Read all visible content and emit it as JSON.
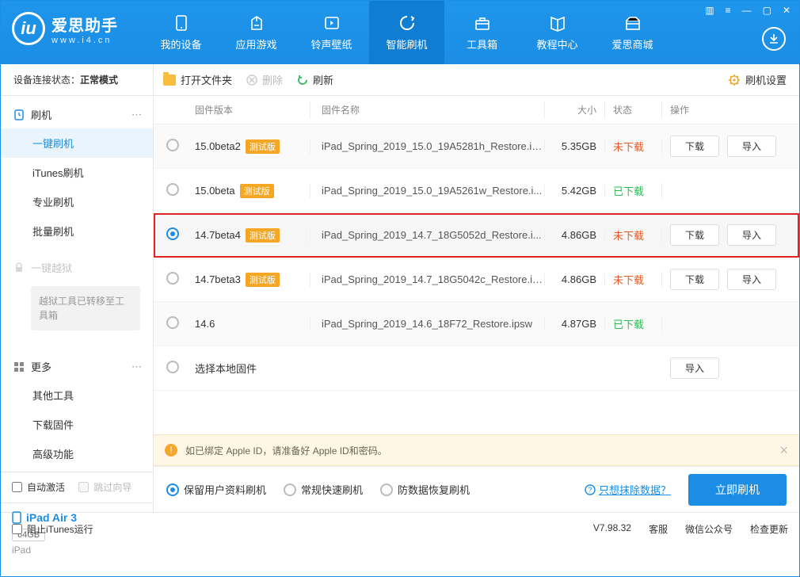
{
  "brand": {
    "title": "爱思助手",
    "sub": "www.i4.cn"
  },
  "nav": {
    "items": [
      "我的设备",
      "应用游戏",
      "铃声壁纸",
      "智能刷机",
      "工具箱",
      "教程中心",
      "爱思商城"
    ],
    "activeIndex": 3
  },
  "connStatus": {
    "label": "设备连接状态：",
    "value": "正常模式"
  },
  "sidebar": {
    "flash": {
      "head": "刷机",
      "items": [
        "一键刷机",
        "iTunes刷机",
        "专业刷机",
        "批量刷机"
      ],
      "activeIndex": 0
    },
    "jailbreak": {
      "head": "一键越狱",
      "note": "越狱工具已转移至工具箱"
    },
    "more": {
      "head": "更多",
      "items": [
        "其他工具",
        "下载固件",
        "高级功能"
      ]
    },
    "autoActivate": "自动激活",
    "skipGuide": "跳过向导",
    "device": {
      "name": "iPad Air 3",
      "storage": "64GB",
      "type": "iPad"
    }
  },
  "toolbar": {
    "open": "打开文件夹",
    "delete": "删除",
    "refresh": "刷新",
    "settings": "刷机设置"
  },
  "table": {
    "headers": {
      "version": "固件版本",
      "name": "固件名称",
      "size": "大小",
      "status": "状态",
      "ops": "操作"
    },
    "betaTag": "测试版",
    "actions": {
      "download": "下载",
      "import": "导入"
    },
    "localRow": "选择本地固件",
    "rows": [
      {
        "version": "15.0beta2",
        "beta": true,
        "name": "iPad_Spring_2019_15.0_19A5281h_Restore.ip...",
        "size": "5.35GB",
        "status": "未下载",
        "statusClass": "red",
        "ops": [
          "download",
          "import"
        ],
        "selected": false
      },
      {
        "version": "15.0beta",
        "beta": true,
        "name": "iPad_Spring_2019_15.0_19A5261w_Restore.i...",
        "size": "5.42GB",
        "status": "已下载",
        "statusClass": "green",
        "ops": [],
        "selected": false
      },
      {
        "version": "14.7beta4",
        "beta": true,
        "name": "iPad_Spring_2019_14.7_18G5052d_Restore.i...",
        "size": "4.86GB",
        "status": "未下载",
        "statusClass": "red",
        "ops": [
          "download",
          "import"
        ],
        "selected": true,
        "highlight": true
      },
      {
        "version": "14.7beta3",
        "beta": true,
        "name": "iPad_Spring_2019_14.7_18G5042c_Restore.ip...",
        "size": "4.86GB",
        "status": "未下载",
        "statusClass": "red",
        "ops": [
          "download",
          "import"
        ],
        "selected": false
      },
      {
        "version": "14.6",
        "beta": false,
        "name": "iPad_Spring_2019_14.6_18F72_Restore.ipsw",
        "size": "4.87GB",
        "status": "已下载",
        "statusClass": "green",
        "ops": [],
        "selected": false
      }
    ]
  },
  "hint": "如已绑定 Apple ID，请准备好 Apple ID和密码。",
  "actionBar": {
    "modes": [
      "保留用户资料刷机",
      "常规快速刷机",
      "防数据恢复刷机"
    ],
    "selectedMode": 0,
    "eraseLink": "只想抹除数据？",
    "primary": "立即刷机"
  },
  "footer": {
    "blockItunes": "阻止iTunes运行",
    "version": "V7.98.32",
    "links": [
      "客服",
      "微信公众号",
      "检查更新"
    ]
  }
}
